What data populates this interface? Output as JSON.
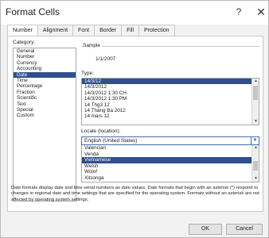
{
  "window": {
    "title": "Format Cells",
    "help": "?",
    "close": "✕"
  },
  "tabs": [
    "Number",
    "Alignment",
    "Font",
    "Border",
    "Fill",
    "Protection"
  ],
  "category": {
    "label": "Category:",
    "items": [
      "General",
      "Number",
      "Currency",
      "Accounting",
      "Date",
      "Time",
      "Percentage",
      "Fraction",
      "Scientific",
      "Text",
      "Special",
      "Custom"
    ],
    "selected_index": 4
  },
  "sample": {
    "label": "Sample",
    "value": "1/1/2007"
  },
  "type": {
    "label": "Type:",
    "items": [
      "14/3/12",
      "14/3/2012",
      "14/3/2012 1:30 CH",
      "14/3/2012 1:30 PM",
      "14 Thg3 12",
      "14 Tháng Ba 2012",
      "14 mars 12"
    ],
    "selected_index": 0
  },
  "locale": {
    "label": "Locale (location):",
    "value": "English (United States)",
    "items": [
      "Valencian",
      "Venda",
      "Vietnamese",
      "Welsh",
      "Wolof",
      "Xitsonga"
    ],
    "selected_index": 2
  },
  "description": "Date formats display date and time serial numbers as date values. Date formats that begin with an asterisk (*) respond to changes in regional date and time settings that are specified for the operating system. Formats without an asterisk are not affected by operating system settings.",
  "buttons": {
    "ok": "OK",
    "cancel": "Cancel"
  }
}
